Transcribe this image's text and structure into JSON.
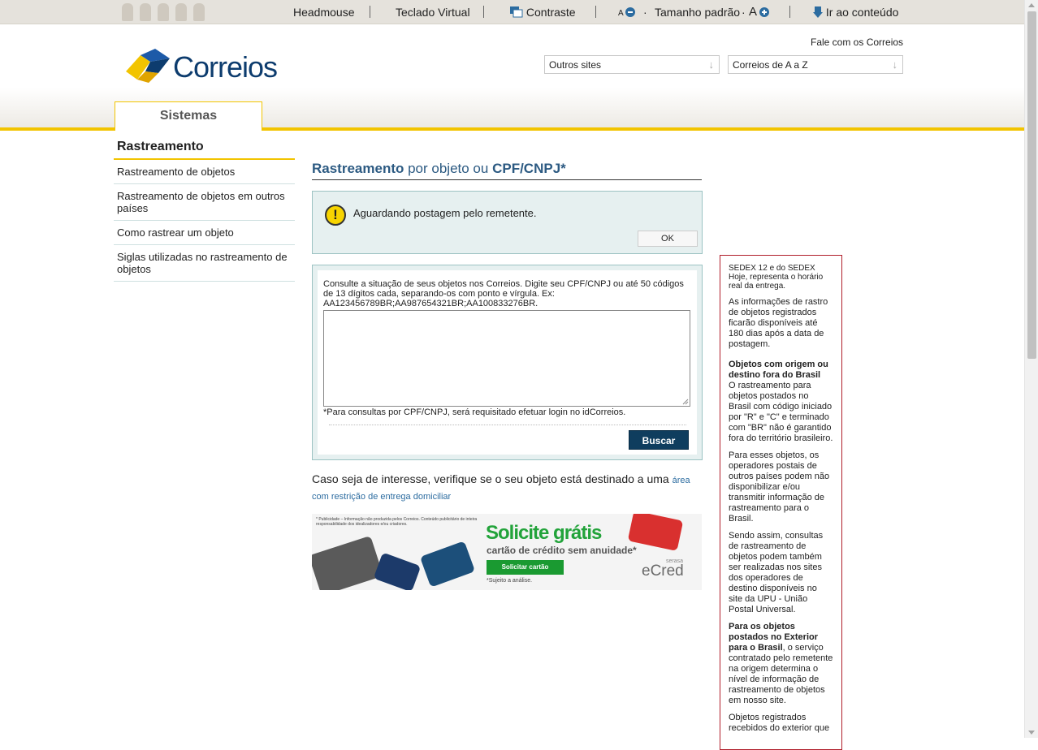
{
  "accessibility": {
    "headmouse": "Headmouse",
    "teclado": "Teclado Virtual",
    "contraste": "Contraste",
    "a_minus": "A",
    "tamanho": "Tamanho padrão",
    "a_plus": "A",
    "ir_conteudo": "Ir ao conteúdo"
  },
  "header": {
    "logo_text": "Correios",
    "fale": "Fale com os Correios",
    "select_outros": "Outros sites",
    "select_correios": "Correios de A a Z",
    "tab": "Sistemas"
  },
  "nav": {
    "title": "Rastreamento",
    "items": [
      "Rastreamento de objetos",
      "Rastreamento de objetos em outros países",
      "Como rastrear um objeto",
      "Siglas utilizadas no rastreamento de objetos"
    ]
  },
  "main": {
    "title_bold": "Rastreamento",
    "title_mid": " por objeto ou ",
    "title_bold2": "CPF/CNPJ*",
    "alert_text": "Aguardando postagem pelo remetente.",
    "ok": "OK",
    "form_desc": "Consulte a situação de seus objetos nos Correios. Digite seu CPF/CNPJ ou até 50 códigos de 13 dígitos cada, separando-os com ponto e vírgula. Ex: AA123456789BR;AA987654321BR;AA100833276BR.",
    "form_note": "*Para consultas por CPF/CNPJ, será requisitado efetuar login no idCorreios.",
    "buscar": "Buscar",
    "caso_text": "Caso seja de interesse, verifique se o seu objeto está destinado a uma ",
    "caso_link": "área com restrição de entrega domiciliar"
  },
  "banner": {
    "small": "* Publicidade – Informação não produzida pelos Correios. Conteúdo publicitário de inteira responsabilidade dos idealizadores e/ou criadores.",
    "solicite": "Solicite grátis",
    "cartao": "cartão de crédito sem anuidade*",
    "btn": "Solicitar cartão",
    "sujeito": "*Sujeito a análise.",
    "serasa": "serasa",
    "ecred": "eCred"
  },
  "sidebar": {
    "p1": "SEDEX 12 e do SEDEX Hoje, representa o horário real da entrega.",
    "p2": "As informações de rastro de objetos registrados ficarão disponíveis até 180 dias após a data de postagem.",
    "h1": "Objetos com origem ou destino fora do Brasil",
    "p3": "O rastreamento para objetos postados no Brasil com código iniciado por \"R\" e \"C\" e terminado com \"BR\" não é garantido fora do território brasileiro.",
    "p4": "Para esses objetos, os operadores postais de outros países podem não disponibilizar e/ou transmitir informação de rastreamento para o Brasil.",
    "p5": "Sendo assim, consultas de rastreamento de objetos podem também ser realizadas nos sites dos operadores de destino disponíveis no site da UPU - União Postal Universal.",
    "h2": "Para os objetos postados no Exterior para o Brasil",
    "p6": ", o serviço contratado pelo remetente na origem determina o nível de informação de rastreamento de objetos em nosso site.",
    "p7": "Objetos registrados recebidos do exterior que"
  }
}
